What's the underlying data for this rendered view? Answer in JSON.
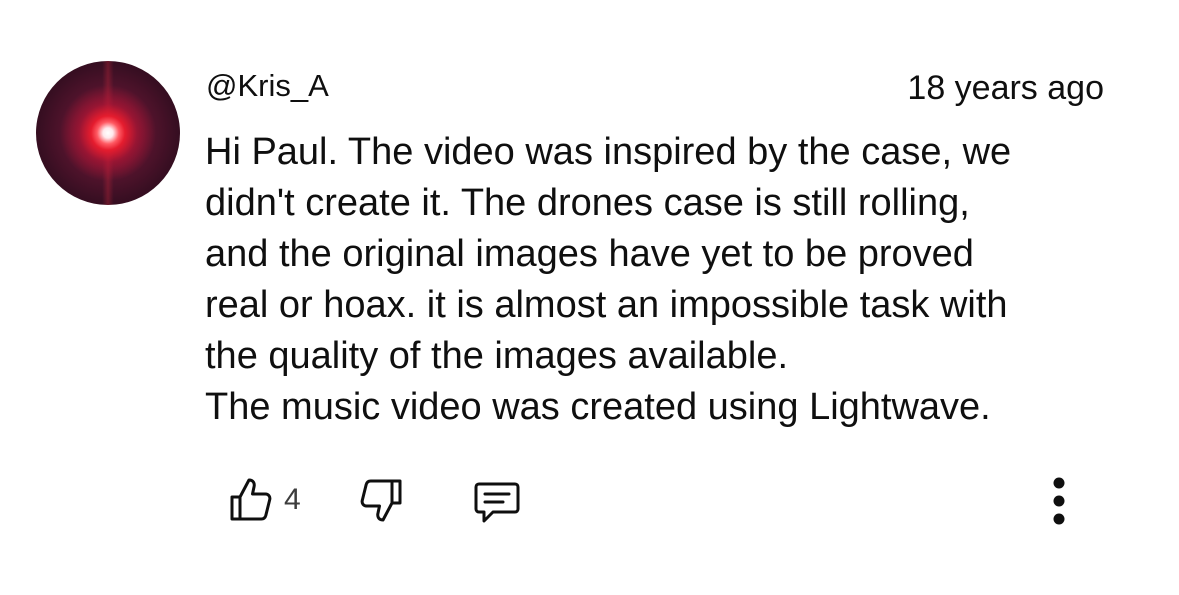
{
  "comment": {
    "author": "@Kris_A",
    "timestamp": "18 years ago",
    "lines": [
      "Hi Paul. The video was inspired by the case, we",
      "didn't create it. The drones case is still rolling,",
      "and the original images have yet to be proved",
      "real or hoax. it is almost an impossible task with",
      "the quality of the images available.",
      "The music video was created using Lightwave."
    ],
    "avatar_icon": "glowing-red-orb"
  },
  "actions": {
    "like_count": "4",
    "like_icon": "thumbs-up-icon",
    "dislike_icon": "thumbs-down-icon",
    "reply_icon": "comment-reply-icon",
    "more_icon": "vertical-ellipsis-icon"
  }
}
